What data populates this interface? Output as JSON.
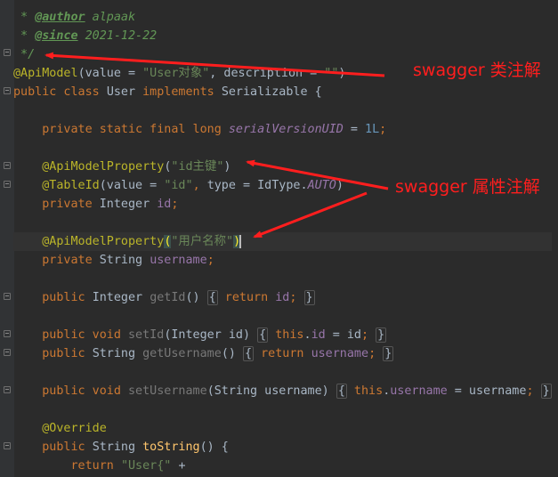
{
  "editor": {
    "lines": [
      [
        {
          "t": " * ",
          "c": "cm"
        },
        {
          "t": "@author",
          "c": "ctag"
        },
        {
          "t": " alpaak",
          "c": "cm"
        }
      ],
      [
        {
          "t": " * ",
          "c": "cm"
        },
        {
          "t": "@since",
          "c": "ctag"
        },
        {
          "t": " 2021-12-22",
          "c": "cm"
        }
      ],
      [
        {
          "t": " */",
          "c": "cm"
        }
      ],
      [
        {
          "t": "@ApiModel",
          "c": "ann"
        },
        {
          "t": "(value = ",
          "c": "pl"
        },
        {
          "t": "\"User对象\"",
          "c": "str"
        },
        {
          "t": ", description = ",
          "c": "pl"
        },
        {
          "t": "\"\"",
          "c": "str"
        },
        {
          "t": ")",
          "c": "pl"
        }
      ],
      [
        {
          "t": "public class ",
          "c": "kw"
        },
        {
          "t": "User ",
          "c": "pl"
        },
        {
          "t": "implements ",
          "c": "kw"
        },
        {
          "t": "Serializable {",
          "c": "pl"
        }
      ],
      [],
      [
        {
          "t": "    private static final long ",
          "c": "kw"
        },
        {
          "t": "serialVersionUID",
          "c": "sf"
        },
        {
          "t": " = ",
          "c": "pl"
        },
        {
          "t": "1L",
          "c": "num"
        },
        {
          "t": ";",
          "c": "kw"
        }
      ],
      [],
      [
        {
          "t": "    "
        },
        {
          "t": "@ApiModelProperty",
          "c": "ann"
        },
        {
          "t": "(",
          "c": "pl"
        },
        {
          "t": "\"id主键\"",
          "c": "str"
        },
        {
          "t": ")",
          "c": "pl"
        }
      ],
      [
        {
          "t": "    "
        },
        {
          "t": "@TableId",
          "c": "ann"
        },
        {
          "t": "(value = ",
          "c": "pl"
        },
        {
          "t": "\"id\"",
          "c": "str"
        },
        {
          "t": ", ",
          "c": "kw"
        },
        {
          "t": "type = IdType.",
          "c": "pl"
        },
        {
          "t": "AUTO",
          "c": "sf"
        },
        {
          "t": ")",
          "c": "pl"
        }
      ],
      [
        {
          "t": "    private ",
          "c": "kw"
        },
        {
          "t": "Integer ",
          "c": "pl"
        },
        {
          "t": "id",
          "c": "fld"
        },
        {
          "t": ";",
          "c": "kw"
        }
      ],
      [],
      [
        {
          "t": "    "
        },
        {
          "t": "@ApiModelProperty",
          "c": "ann"
        },
        {
          "t": "(",
          "c": "matchp"
        },
        {
          "t": "\"用户名称\"",
          "c": "str"
        },
        {
          "t": ")",
          "c": "matchp"
        },
        {
          "t": "",
          "c": "caret"
        }
      ],
      [
        {
          "t": "    private ",
          "c": "kw"
        },
        {
          "t": "String ",
          "c": "pl"
        },
        {
          "t": "username",
          "c": "fld"
        },
        {
          "t": ";",
          "c": "kw"
        }
      ],
      [],
      [
        {
          "t": "    public ",
          "c": "kw"
        },
        {
          "t": "Integer ",
          "c": "pl"
        },
        {
          "t": "getId",
          "c": "gr"
        },
        {
          "t": "() ",
          "c": "pl"
        },
        {
          "t": "{",
          "c": "pl fbox"
        },
        {
          "t": " return ",
          "c": "kw"
        },
        {
          "t": "id",
          "c": "fld"
        },
        {
          "t": "; ",
          "c": "kw"
        },
        {
          "t": "}",
          "c": "pl fbox"
        }
      ],
      [],
      [
        {
          "t": "    public void ",
          "c": "kw"
        },
        {
          "t": "setId",
          "c": "gr"
        },
        {
          "t": "(Integer id) ",
          "c": "pl"
        },
        {
          "t": "{",
          "c": "pl fbox"
        },
        {
          "t": " this",
          "c": "kw"
        },
        {
          "t": ".",
          "c": "pl"
        },
        {
          "t": "id",
          "c": "fld"
        },
        {
          "t": " = id",
          "c": "pl"
        },
        {
          "t": "; ",
          "c": "kw"
        },
        {
          "t": "}",
          "c": "pl fbox"
        }
      ],
      [
        {
          "t": "    public ",
          "c": "kw"
        },
        {
          "t": "String ",
          "c": "pl"
        },
        {
          "t": "getUsername",
          "c": "gr"
        },
        {
          "t": "() ",
          "c": "pl"
        },
        {
          "t": "{",
          "c": "pl fbox"
        },
        {
          "t": " return ",
          "c": "kw"
        },
        {
          "t": "username",
          "c": "fld"
        },
        {
          "t": "; ",
          "c": "kw"
        },
        {
          "t": "}",
          "c": "pl fbox"
        }
      ],
      [],
      [
        {
          "t": "    public void ",
          "c": "kw"
        },
        {
          "t": "setUsername",
          "c": "gr"
        },
        {
          "t": "(String username) ",
          "c": "pl"
        },
        {
          "t": "{",
          "c": "pl fbox"
        },
        {
          "t": " this",
          "c": "kw"
        },
        {
          "t": ".",
          "c": "pl"
        },
        {
          "t": "username",
          "c": "fld"
        },
        {
          "t": " = username",
          "c": "pl"
        },
        {
          "t": "; ",
          "c": "kw"
        },
        {
          "t": "}",
          "c": "pl fbox"
        }
      ],
      [],
      [
        {
          "t": "    "
        },
        {
          "t": "@Override",
          "c": "ann"
        }
      ],
      [
        {
          "t": "    public ",
          "c": "kw"
        },
        {
          "t": "String ",
          "c": "pl"
        },
        {
          "t": "toString",
          "c": "fn"
        },
        {
          "t": "() {",
          "c": "pl"
        }
      ],
      [
        {
          "t": "        return ",
          "c": "kw"
        },
        {
          "t": "\"User{\" ",
          "c": "str"
        },
        {
          "t": "+",
          "c": "pl"
        }
      ]
    ]
  },
  "annotations": {
    "class_label": "swagger 类注解",
    "property_label": "swagger 属性注解",
    "color": "#ff1e1e"
  },
  "icons": {
    "gutter_bulb": "lightbulb-icon",
    "fold_marker": "fold-icon"
  }
}
